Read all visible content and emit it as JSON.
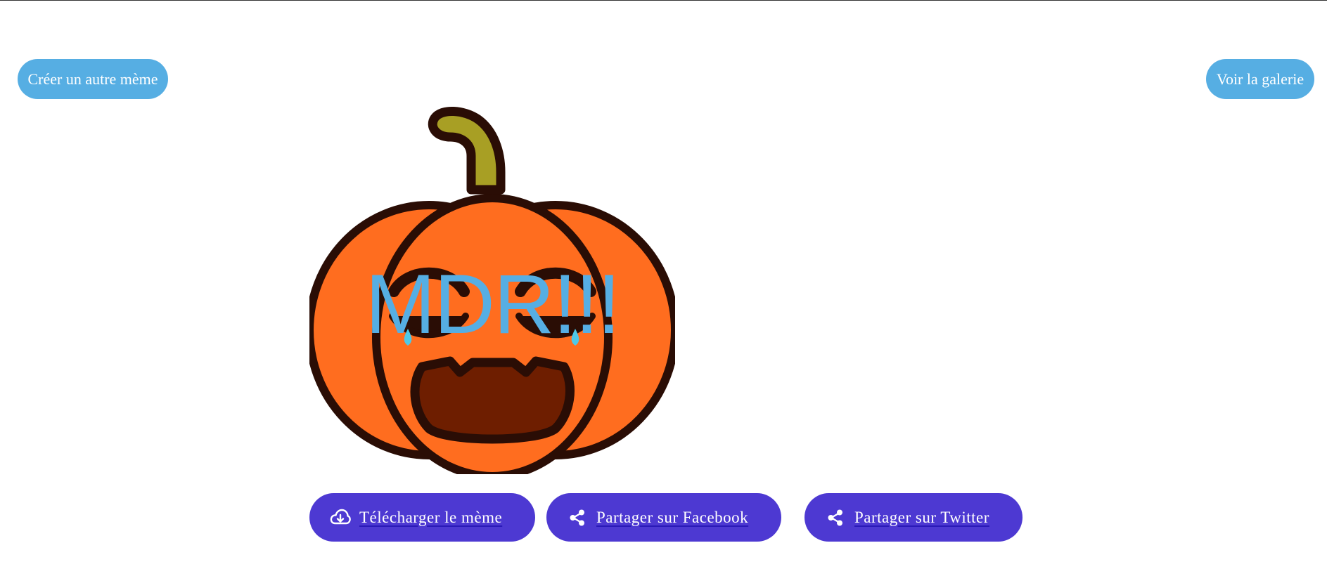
{
  "header": {
    "create_button_label": "Créer un autre mème",
    "gallery_button_label": "Voir la galerie"
  },
  "meme": {
    "caption": "MDR!!!",
    "caption_color": "#56aee3",
    "image_subject": "laughing-pumpkin",
    "colors": {
      "pumpkin": "#ff6d1f",
      "outline": "#2a0d05",
      "stem": "#a89f24",
      "mouth": "#6e1e00",
      "tears": "#4ec9e8"
    }
  },
  "actions": {
    "download_label": "Télécharger le mème",
    "download_icon": "cloud-download-icon",
    "facebook_label": "Partager sur Facebook",
    "facebook_icon": "share-icon",
    "twitter_label": "Partager sur Twitter",
    "twitter_icon": "share-icon",
    "button_color": "#4d39d2"
  },
  "theme": {
    "accent_light": "#56aee3",
    "accent_dark": "#4d39d2"
  }
}
